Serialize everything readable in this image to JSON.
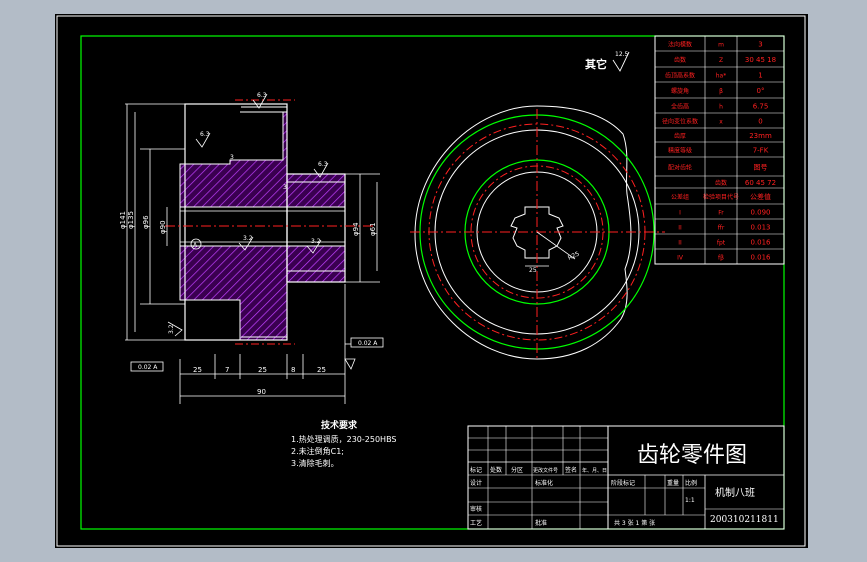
{
  "title_block": {
    "drawing_title": "齿轮零件图",
    "class_name": "机制八班",
    "student_id": "200310211811",
    "scale": "1:1",
    "sheet_text": "共 3  张 1 第   张",
    "row_labels": [
      "设计",
      "审核",
      "工艺"
    ],
    "header_cells": [
      "标记",
      "处数",
      "分区",
      "更改文件号",
      "签名",
      "年、月、日"
    ],
    "mid_labels": [
      "标准化",
      "批准"
    ],
    "right_labels": [
      "阶段标记",
      "重量",
      "比例"
    ]
  },
  "gear_table": {
    "rows": [
      {
        "label": "法向模数",
        "sym": "m",
        "val": "3"
      },
      {
        "label": "齿数",
        "sym": "Z",
        "val": "30 45 18"
      },
      {
        "label": "齿顶高系数",
        "sym": "ha*",
        "val": "1"
      },
      {
        "label": "螺旋角",
        "sym": "β",
        "val": "0°"
      },
      {
        "label": "全齿高",
        "sym": "h",
        "val": "6.75"
      },
      {
        "label": "径向变位系数",
        "sym": "x",
        "val": "0"
      },
      {
        "label": "齿厚",
        "sym": "",
        "val": "23mm"
      },
      {
        "label": "精度等级",
        "sym": "",
        "val": "7-FK"
      },
      {
        "label": "配对齿轮",
        "sym": "",
        "val": "图号"
      },
      {
        "label": "",
        "sym": "齿数",
        "val": "60 45 72"
      },
      {
        "label": "公差组",
        "sym": "检验项目代号",
        "val": "公差值"
      },
      {
        "label": "I",
        "sym": "Fr",
        "val": "0.090"
      },
      {
        "label": "II",
        "sym": "ffr",
        "val": "0.013"
      },
      {
        "label": "II",
        "sym": "fpt",
        "val": "0.016"
      },
      {
        "label": "IV",
        "sym": "fβ",
        "val": "0.016"
      }
    ]
  },
  "tech_req": {
    "heading": "技术要求",
    "items": [
      "1.热处理调质，230-250HBS",
      "2.未注倒角C1;",
      "3.清除毛刺。"
    ]
  },
  "roughness": {
    "other_label": "其它",
    "other_value": "12.5",
    "values": [
      "6.3",
      "6.3",
      "6.3",
      "3.2",
      "3.2",
      "3.2"
    ]
  },
  "section_dims": {
    "left": [
      "φ141",
      "φ135",
      "φ96",
      "φ90",
      "φ94",
      "φ61"
    ],
    "bottom": [
      "25",
      "7",
      "25",
      "8",
      "25",
      "90"
    ],
    "tolerances": [
      "0.02 A",
      "0.02 A"
    ],
    "datum": "A",
    "small": [
      "3",
      "3"
    ]
  },
  "round_view": {
    "keyway": "25",
    "bore": "R25"
  },
  "colors": {
    "background": "#b3bcc7",
    "sheet": "#000000",
    "frame": "#00ff00",
    "hatch": "#a020f0",
    "center": "#ff2020",
    "text": "#ffffff",
    "dim": "#ffff00"
  }
}
